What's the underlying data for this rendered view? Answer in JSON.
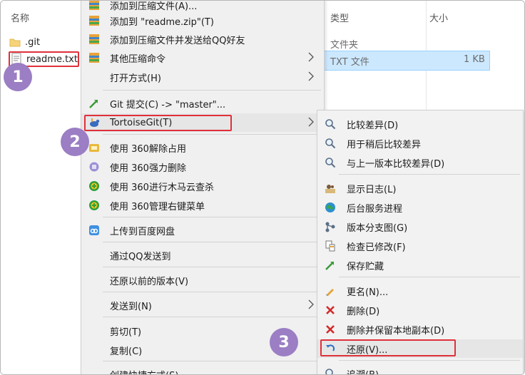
{
  "explorer": {
    "columns": {
      "name": "名称",
      "type": "类型",
      "size": "大小"
    },
    "files": [
      {
        "name": ".git",
        "type": "文件夹",
        "size": ""
      },
      {
        "name": "readme.txt",
        "type": "TXT 文件",
        "size": "1 KB"
      }
    ]
  },
  "context_menu": {
    "items": [
      {
        "label": "添加到压缩文件(A)...",
        "icon": "archive-icon"
      },
      {
        "label": "添加到 \"readme.zip\"(T)",
        "icon": "archive-icon"
      },
      {
        "label": "添加到压缩文件并发送给QQ好友",
        "icon": "archive-icon"
      },
      {
        "label": "其他压缩命令",
        "icon": "archive-icon"
      },
      {
        "label": "打开方式(H)"
      },
      {
        "label": "Git 提交(C) -> \"master\"...",
        "icon": "git-commit-icon"
      },
      {
        "label": "TortoiseGit(T)",
        "icon": "tortoisegit-icon"
      },
      {
        "label": "使用 360解除占用",
        "icon": "unlock-icon"
      },
      {
        "label": "使用 360强力删除",
        "icon": "shred-icon"
      },
      {
        "label": "使用 360进行木马云查杀",
        "icon": "360-scan-icon"
      },
      {
        "label": "使用 360管理右键菜单",
        "icon": "360-manage-icon"
      },
      {
        "label": "上传到百度网盘",
        "icon": "baidu-cloud-icon"
      },
      {
        "label": "通过QQ发送到"
      },
      {
        "label": "还原以前的版本(V)"
      },
      {
        "label": "发送到(N)"
      },
      {
        "label": "剪切(T)"
      },
      {
        "label": "复制(C)"
      },
      {
        "label": "创建快捷方式(S)"
      }
    ]
  },
  "tortoisegit_submenu": {
    "items": [
      {
        "label": "比较差异(D)",
        "icon": "diff-icon"
      },
      {
        "label": "用于稍后比较差异",
        "icon": "diff-later-icon"
      },
      {
        "label": "与上一版本比较差异(D)",
        "icon": "diff-prev-icon"
      },
      {
        "label": "显示日志(L)",
        "icon": "log-icon"
      },
      {
        "label": "后台服务进程",
        "icon": "daemon-icon"
      },
      {
        "label": "版本分支图(G)",
        "icon": "revision-graph-icon"
      },
      {
        "label": "检查已修改(F)",
        "icon": "check-modified-icon"
      },
      {
        "label": "保存贮藏",
        "icon": "stash-icon"
      },
      {
        "label": "更名(N)...",
        "icon": "rename-icon"
      },
      {
        "label": "删除(D)",
        "icon": "delete-icon"
      },
      {
        "label": "删除并保留本地副本(D)",
        "icon": "delete-keep-icon"
      },
      {
        "label": "还原(V)...",
        "icon": "revert-icon"
      },
      {
        "label": "追溯(B)...",
        "icon": "blame-icon"
      }
    ]
  },
  "badges": [
    "1",
    "2",
    "3"
  ],
  "colors": {
    "annotation_red": "#e0303a",
    "badge_purple": "#9b7ec4",
    "selection_blue": "#cce8ff",
    "menu_bg": "#f0f0f0"
  }
}
